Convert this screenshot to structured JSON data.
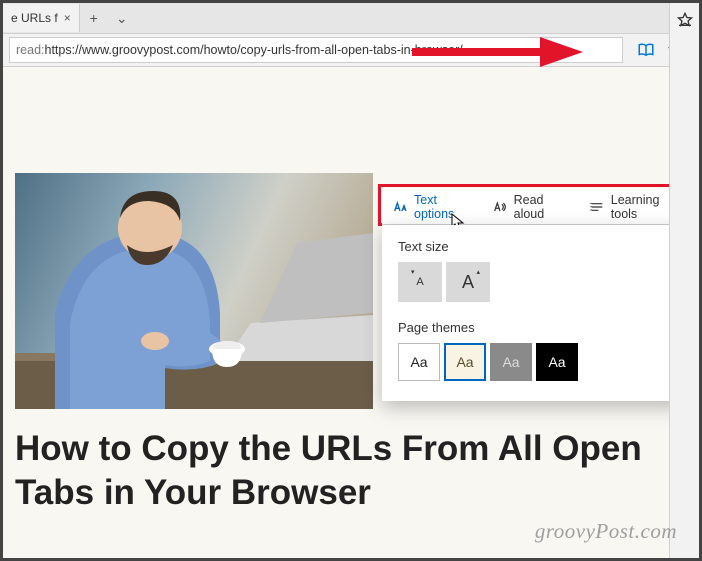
{
  "tab": {
    "title": "e URLs f",
    "close": "×",
    "plus": "+",
    "chev": "⌄"
  },
  "address": {
    "scheme": "read:",
    "url": "https://www.groovypost.com/howto/copy-urls-from-all-open-tabs-in-browser/"
  },
  "toolbar_icons": {
    "reading": "book-icon",
    "star": "star-icon",
    "fav": "favorites-icon",
    "more": "more-icon"
  },
  "reading_menu": {
    "text_options": "Text options",
    "read_aloud": "Read aloud",
    "learning_tools": "Learning tools"
  },
  "panel": {
    "text_size_label": "Text size",
    "size_small": "A",
    "size_big": "A",
    "page_themes_label": "Page themes",
    "theme_sample": "Aa"
  },
  "article": {
    "headline": "How to Copy the URLs From All Open Tabs in Your Browser"
  },
  "watermark": "groovyPost.com"
}
